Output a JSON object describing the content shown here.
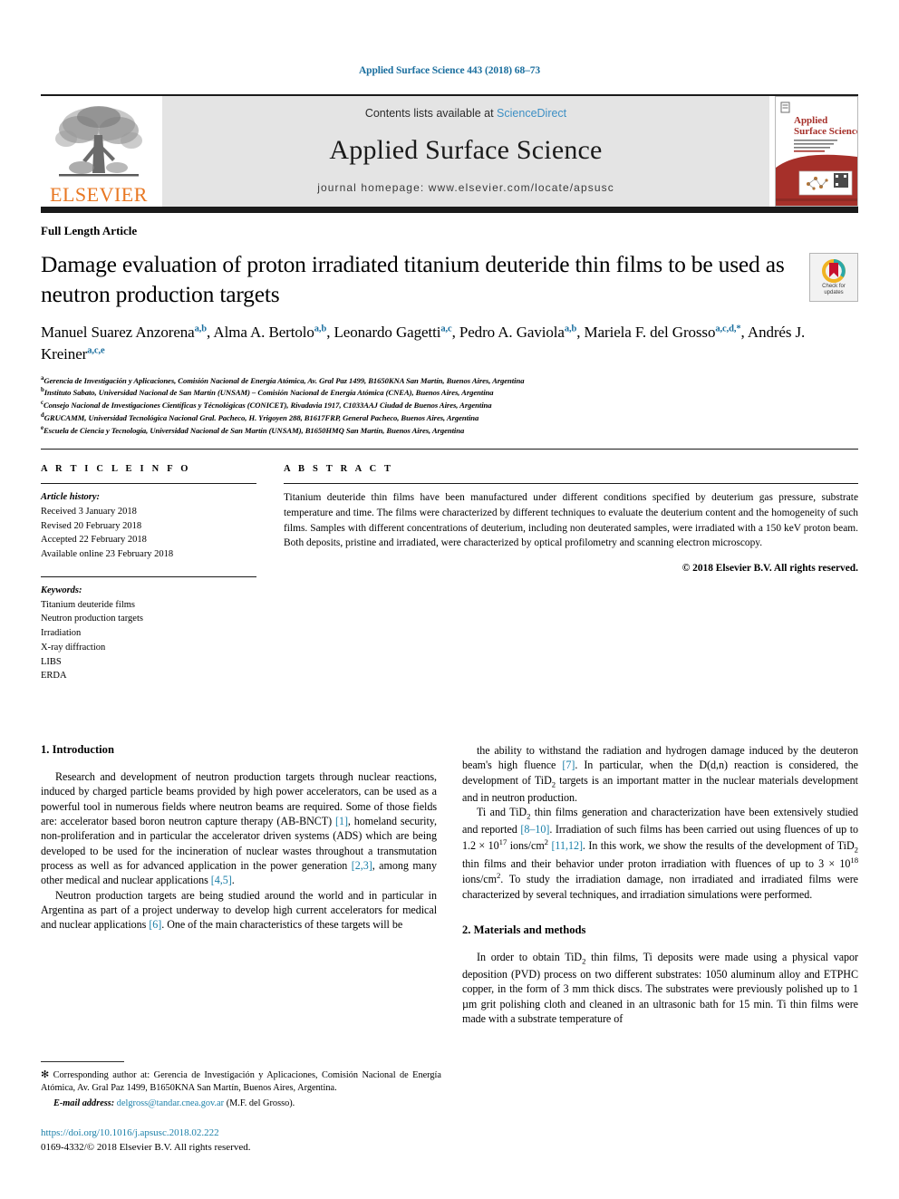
{
  "running_head": "Applied Surface Science 443 (2018) 68–73",
  "masthead": {
    "publisher_name": "ELSEVIER",
    "contents_prefix": "Contents lists available at ",
    "sciencedirect_link": "ScienceDirect",
    "journal_title": "Applied Surface Science",
    "homepage_line": "journal homepage: www.elsevier.com/locate/apsusc",
    "cover_title_line1": "Applied",
    "cover_title_line2": "Surface Science"
  },
  "article_type": "Full Length Article",
  "title": "Damage evaluation of proton irradiated titanium deuteride thin films to be used as neutron production targets",
  "crossmark": {
    "line1": "Check for",
    "line2": "updates"
  },
  "authors_html": "Manuel Suarez Anzorena<sup>a,b</sup>, Alma A. Bertolo<sup>a,b</sup>, Leonardo Gagetti<sup>a,c</sup>, Pedro A. Gaviola<sup>a,b</sup>, Mariela F. del Grosso<sup>a,c,d,</sup><sup>*</sup>, Andrés J. Kreiner<sup>a,c,e</sup>",
  "affiliations": [
    {
      "marker": "a",
      "text": "Gerencia de Investigación y Aplicaciones, Comisión Nacional de Energía Atómica, Av. Gral Paz 1499, B1650KNA San Martín, Buenos Aires, Argentina"
    },
    {
      "marker": "b",
      "text": "Instituto Sabato, Universidad Nacional de San Martín (UNSAM) – Comisión Nacional de Energía Atómica (CNEA), Buenos Aires, Argentina"
    },
    {
      "marker": "c",
      "text": "Consejo Nacional de Investigaciones Científicas y Técnológicas (CONICET), Rivadavia 1917, C1033AAJ Ciudad de Buenos Aires, Argentina"
    },
    {
      "marker": "d",
      "text": "GRUCAMM, Universidad Tecnológica Nacional Gral. Pacheco, H. Yrigoyen 288, B1617FRP, General Pacheco, Buenos Aires, Argentina"
    },
    {
      "marker": "e",
      "text": "Escuela de Ciencia y Tecnología, Universidad Nacional de San Martín (UNSAM), B1650HMQ San Martín, Buenos Aires, Argentina"
    }
  ],
  "article_info": {
    "heading": "A R T I C L E   I N F O",
    "history_label": "Article history:",
    "history": [
      "Received 3 January 2018",
      "Revised 20 February 2018",
      "Accepted 22 February 2018",
      "Available online 23 February 2018"
    ],
    "keywords_label": "Keywords:",
    "keywords": [
      "Titanium deuteride films",
      "Neutron production targets",
      "Irradiation",
      "X-ray diffraction",
      "LIBS",
      "ERDA"
    ]
  },
  "abstract": {
    "heading": "A B S T R A C T",
    "text": "Titanium deuteride thin films have been manufactured under different conditions specified by deuterium gas pressure, substrate temperature and time. The films were characterized by different techniques to evaluate the deuterium content and the homogeneity of such films. Samples with different concentrations of deuterium, including non deuterated samples, were irradiated with a 150 keV proton beam. Both deposits, pristine and irradiated, were characterized by optical profilometry and scanning electron microscopy.",
    "copyright": "© 2018 Elsevier B.V. All rights reserved."
  },
  "body": {
    "intro_heading": "1. Introduction",
    "intro_p1_html": "Research and development of neutron production targets through nuclear reactions, induced by charged particle beams provided by high power accelerators, can be used as a powerful tool in numerous fields where neutron beams are required. Some of those fields are: accelerator based boron neutron capture therapy (AB-BNCT) <span class=\"ref\">[1]</span>, homeland security, non-proliferation and in particular the accelerator driven systems (ADS) which are being developed to be used for the incineration of nuclear wastes throughout a transmutation process as well as for advanced application in the power generation <span class=\"ref\">[2,3]</span>, among many other medical and nuclear applications <span class=\"ref\">[4,5]</span>.",
    "intro_p2_html": "Neutron production targets are being studied around the world and in particular in Argentina as part of a project underway to develop high current accelerators for medical and nuclear applications <span class=\"ref\">[6]</span>. One of the main characteristics of these targets will be",
    "right_p1_html": "the ability to withstand the radiation and hydrogen damage induced by the deuteron beam's high fluence <span class=\"ref\">[7]</span>. In particular, when the D(d,n) reaction is considered, the development of TiD<sub>2</sub> targets is an important matter in the nuclear materials development and in neutron production.",
    "right_p2_html": "Ti and TiD<sub>2</sub> thin films generation and characterization have been extensively studied and reported <span class=\"ref\">[8–10]</span>. Irradiation of such films has been carried out using fluences of up to 1.2 × 10<sup>17</sup> ions/cm<sup>2</sup> <span class=\"ref\">[11,12]</span>. In this work, we show the results of the development of TiD<sub>2</sub> thin films and their behavior under proton irradiation with fluences of up to 3 × 10<sup>18</sup> ions/cm<sup>2</sup>. To study the irradiation damage, non irradiated and irradiated films were characterized by several techniques, and irradiation simulations were performed.",
    "methods_heading": "2. Materials and methods",
    "methods_p1_html": "In order to obtain TiD<sub>2</sub> thin films, Ti deposits were made using a physical vapor deposition (PVD) process on two different substrates: 1050 aluminum alloy and ETPHC copper, in the form of 3 mm thick discs. The substrates were previously polished up to 1 µm grit polishing cloth and cleaned in an ultrasonic bath for 15 min. Ti thin films were made with a substrate temperature of"
  },
  "footnote": {
    "corresponding_html": "<span style=\"font-size:11px\">✻</span> Corresponding author at: Gerencia de Investigación y Aplicaciones, Comisión Nacional de Energía Atómica, Av. Gral Paz 1499, B1650KNA San Martín, Buenos Aires, Argentina.",
    "email_label": "E-mail address:",
    "email": "delgross@tandar.cnea.gov.ar",
    "email_suffix": " (M.F. del Grosso).",
    "doi": "https://doi.org/10.1016/j.apsusc.2018.02.222",
    "issn_line": "0169-4332/© 2018 Elsevier B.V. All rights reserved."
  },
  "colors": {
    "link": "#1a7fa8",
    "running_head": "#1a6e9e",
    "elsevier_orange": "#e87722",
    "sciencedirect": "#3c8fc4",
    "masthead_bg": "#e4e4e4"
  }
}
